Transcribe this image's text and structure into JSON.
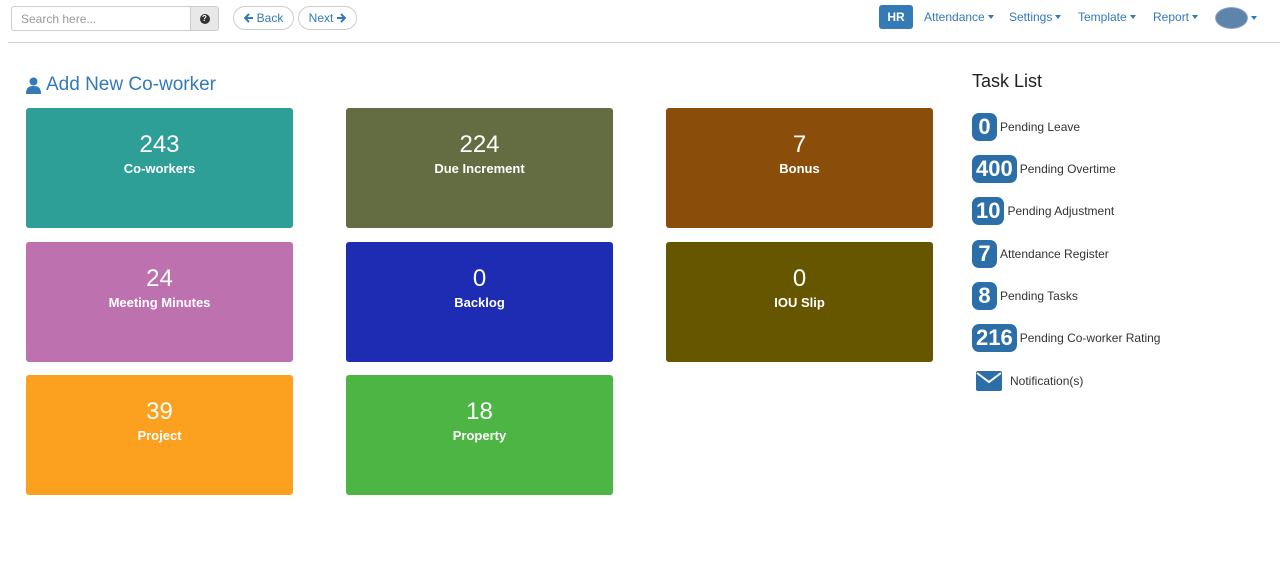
{
  "search": {
    "placeholder": "Search here...",
    "help_icon": "question-circle-icon"
  },
  "nav": {
    "back_label": "Back",
    "next_label": "Next"
  },
  "header": {
    "hr_label": "HR",
    "menus": [
      "Attendance",
      "Settings",
      "Template",
      "Report"
    ],
    "avatar_icon": "user-avatar"
  },
  "add_coworker_label": "Add New Co-worker",
  "tiles": [
    {
      "value": "243",
      "label": "Co-workers",
      "color": "#2e9f96"
    },
    {
      "value": "224",
      "label": "Due Increment",
      "color": "#646c42"
    },
    {
      "value": "7",
      "label": "Bonus",
      "color": "#8b4e0a"
    },
    {
      "value": "24",
      "label": "Meeting Minutes",
      "color": "#bd72af"
    },
    {
      "value": "0",
      "label": "Backlog",
      "color": "#1e2bb3"
    },
    {
      "value": "0",
      "label": "IOU Slip",
      "color": "#665600"
    },
    {
      "value": "39",
      "label": "Project",
      "color": "#fba11f"
    },
    {
      "value": "18",
      "label": "Property",
      "color": "#4db543"
    }
  ],
  "task_list": {
    "title": "Task List",
    "items": [
      {
        "count": "0",
        "label": "Pending Leave"
      },
      {
        "count": "400",
        "label": "Pending Overtime"
      },
      {
        "count": "10",
        "label": "Pending Adjustment"
      },
      {
        "count": "7",
        "label": "Attendance Register"
      },
      {
        "count": "8",
        "label": "Pending Tasks"
      },
      {
        "count": "216",
        "label": "Pending Co-worker Rating"
      }
    ],
    "notification_label": "Notification(s)",
    "notification_icon": "envelope-icon"
  },
  "colors": {
    "accent": "#337ab7",
    "badge": "#2c6ea8"
  }
}
